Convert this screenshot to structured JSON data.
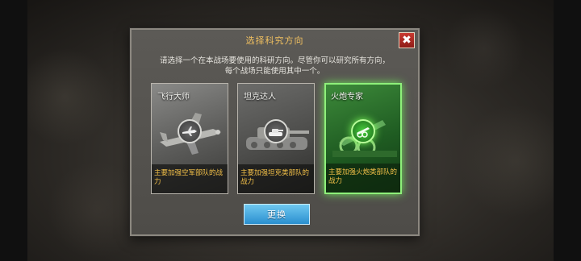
{
  "dialog": {
    "title": "选择科究方向",
    "close_label": "✖",
    "description_line1": "请选择一个在本战场要使用的科研方向。尽管你可以研究所有方向，",
    "description_line2": "每个战场只能使用其中一个。",
    "cards": [
      {
        "name": "飞行大师",
        "icon": "airplane-icon",
        "desc": "主要加强空军部队的战力",
        "selected": false
      },
      {
        "name": "坦克达人",
        "icon": "tank-icon",
        "desc": "主要加强坦克类部队的战力",
        "selected": false
      },
      {
        "name": "火炮专家",
        "icon": "artillery-icon",
        "desc": "主要加强火炮类部队的战力",
        "selected": true
      }
    ],
    "change_button": "更换"
  },
  "colors": {
    "title": "#f0c060",
    "card_desc": "#f3c048",
    "selected_glow": "#6fe05a",
    "button": "#2a8fd0",
    "close": "#c93a30"
  }
}
